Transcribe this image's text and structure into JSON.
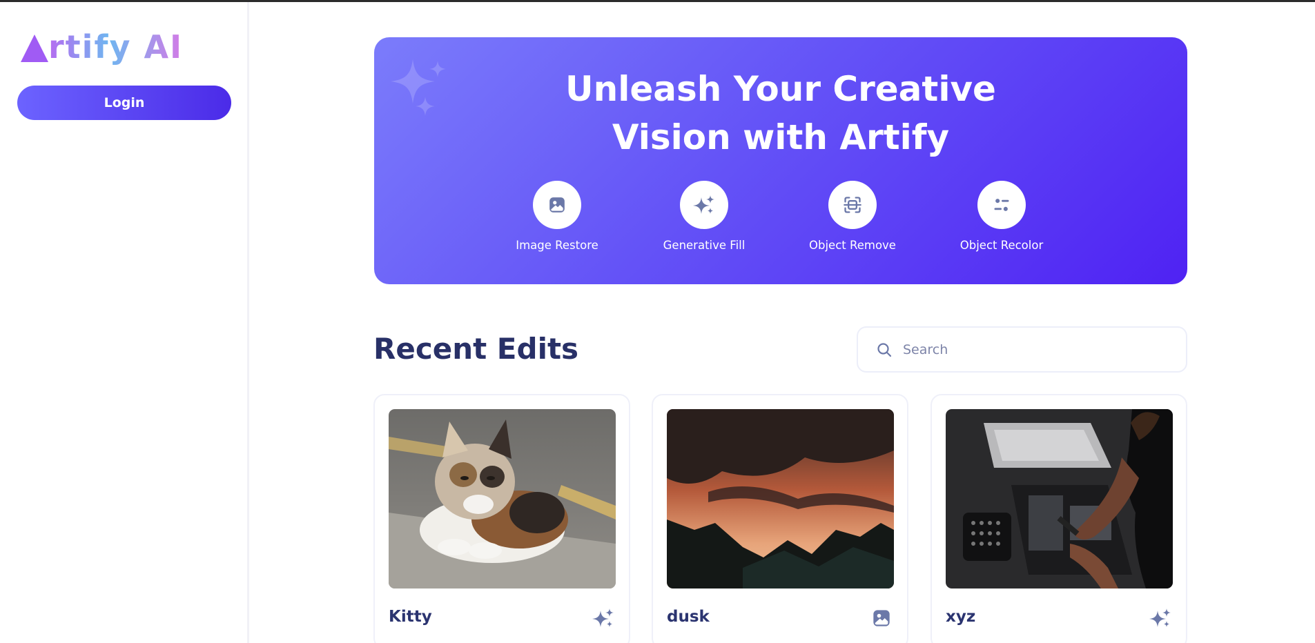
{
  "brand": {
    "logo_text": "rtify AI",
    "logo_alt": "Artify AI"
  },
  "sidebar": {
    "login_label": "Login"
  },
  "hero": {
    "title_line1": "Unleash Your Creative",
    "title_line2": "Vision with Artify",
    "tools": [
      {
        "label": "Image Restore",
        "icon": "image-icon"
      },
      {
        "label": "Generative Fill",
        "icon": "sparkles-icon"
      },
      {
        "label": "Object Remove",
        "icon": "scan-icon"
      },
      {
        "label": "Object Recolor",
        "icon": "filter-icon"
      }
    ]
  },
  "recent": {
    "title": "Recent Edits",
    "search_placeholder": "Search",
    "cards": [
      {
        "title": "Kitty",
        "image": "photo of a calico cat on pavement",
        "icon": "sparkles-icon"
      },
      {
        "title": "dusk",
        "image": "sunset sky over mountain silhouette",
        "icon": "image-icon"
      },
      {
        "title": "xyz",
        "image": "person repairing laptop internals",
        "icon": "sparkles-icon"
      }
    ]
  },
  "colors": {
    "accent": "#5b3cf5",
    "hero_gradient_start": "#7b7cfb",
    "hero_gradient_end": "#4f22f3",
    "heading": "#283067",
    "icon": "#6b78a8"
  }
}
